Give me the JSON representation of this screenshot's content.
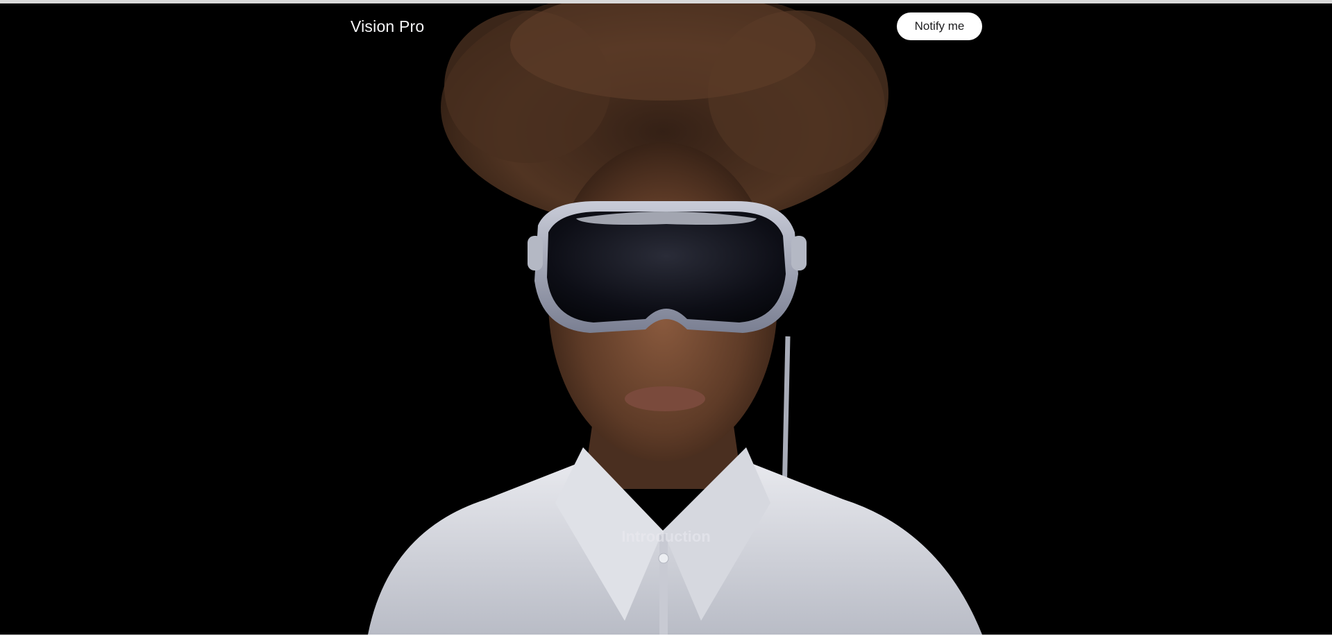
{
  "header": {
    "brand": "Vision Pro",
    "notify_label": "Notify me"
  },
  "hero": {
    "caption": "Introduction",
    "icons": [
      "headset-wearer-illustration"
    ]
  },
  "colors": {
    "background": "#000000",
    "button_bg": "#ffffff",
    "button_text": "#1d1d1f",
    "brand_text": "#f5f5f7"
  }
}
